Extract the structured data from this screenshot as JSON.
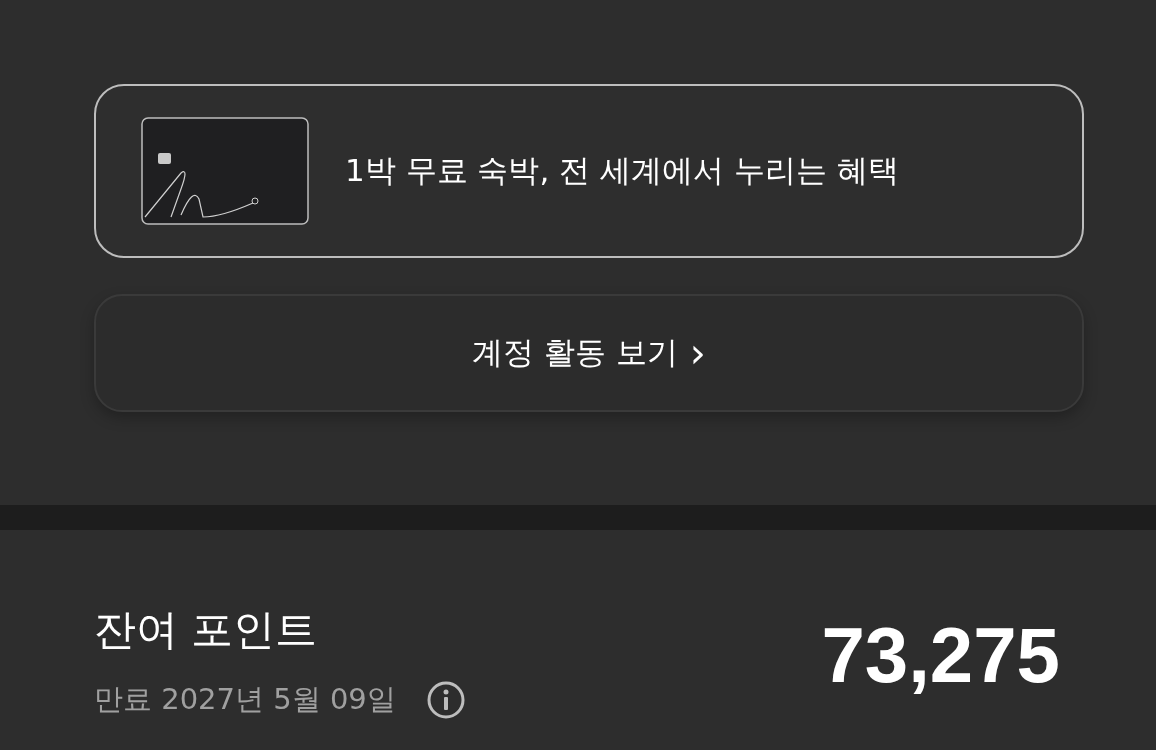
{
  "benefit_card": {
    "text": "1박 무료 숙박, 전 세계에서 누리는 혜택"
  },
  "activity_button": {
    "label": "계정 활동 보기",
    "chevron": "›"
  },
  "points": {
    "label": "잔여 포인트",
    "expiry": "만료 2027년 5월 09일",
    "value": "73,275"
  }
}
